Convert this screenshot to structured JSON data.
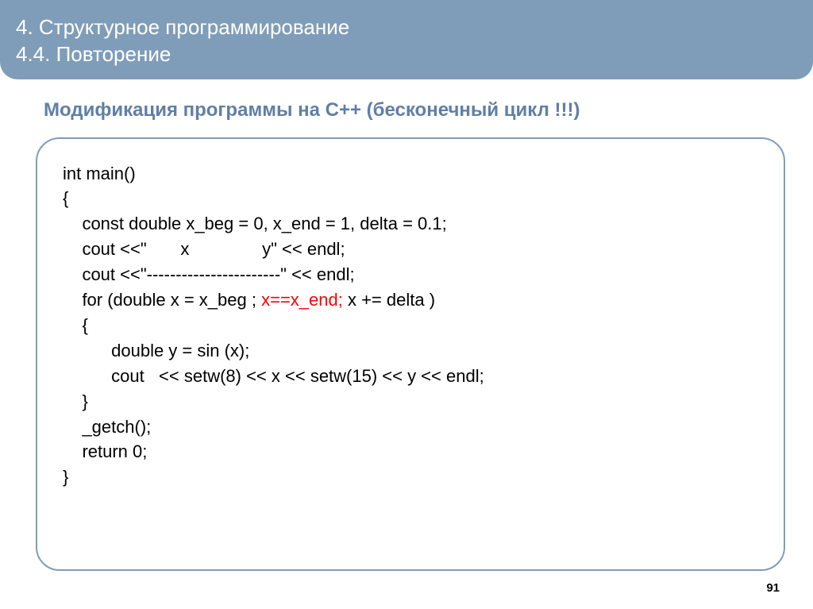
{
  "header": {
    "title": "4. Структурное программирование",
    "subtitle": "4.4. Повторение"
  },
  "section": {
    "title": "Модификация программы на C++    (бесконечный  цикл !!!)"
  },
  "code": {
    "line1": "int main()",
    "line2": "{",
    "line3": "    const double x_beg = 0, x_end = 1, delta = 0.1;",
    "line4": "    cout <<\"       x               y\" << endl;",
    "line5": "    cout <<\"-----------------------\" << endl;",
    "line6a": "    for (double x = x_beg ; ",
    "line6b": "x==x_end;",
    "line6c": " x += delta )",
    "line7": "    {",
    "line8": "          double y = sin (x);",
    "line9": "          cout   << setw(8) << x << setw(15) << y << endl;",
    "line10": "    }",
    "line11": "    _getch();",
    "line12": "    return 0;",
    "line13": "}"
  },
  "page": {
    "number": "91"
  }
}
